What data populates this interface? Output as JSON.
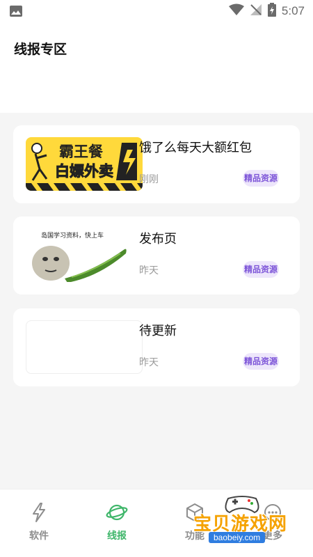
{
  "status_bar": {
    "time": "5:07"
  },
  "page": {
    "title": "线报专区"
  },
  "cards": [
    {
      "title": "饿了么每天大额红包",
      "time": "刚刚",
      "tag": "精品资源",
      "thumb_text": [
        "霸王餐",
        "白嫖外卖"
      ]
    },
    {
      "title": "发布页",
      "time": "昨天",
      "tag": "精品资源",
      "thumb_text": [
        "岛国学习资料，快上车"
      ]
    },
    {
      "title": "待更新",
      "time": "昨天",
      "tag": "精品资源"
    }
  ],
  "nav": {
    "items": [
      {
        "label": "软件",
        "icon": "lightning-icon",
        "active": false
      },
      {
        "label": "线报",
        "icon": "planet-icon",
        "active": true
      },
      {
        "label": "功能",
        "icon": "cube-icon",
        "active": false
      },
      {
        "label": "更多",
        "icon": "more-icon",
        "active": false
      }
    ],
    "active_color": "#3fb66a",
    "inactive_color": "#8d8d8d"
  },
  "watermark": {
    "text": "宝贝游戏网",
    "url": "baobeiy.com"
  },
  "colors": {
    "tag_bg": "#ede6fb",
    "tag_text": "#7d55d8",
    "content_bg": "#f5f5f5"
  }
}
